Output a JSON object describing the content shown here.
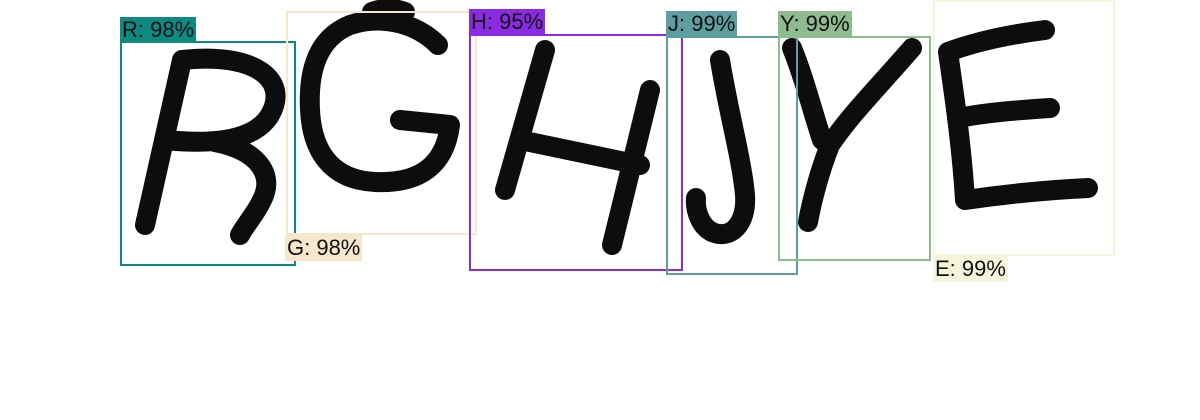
{
  "detections": [
    {
      "name": "R",
      "label": "R: 98%",
      "color": "#0e8a80"
    },
    {
      "name": "G",
      "label": "G: 98%",
      "color": "#f5e6cc"
    },
    {
      "name": "H",
      "label": "H: 95%",
      "color": "#8a2be2"
    },
    {
      "name": "J",
      "label": "J: 99%",
      "color": "#5f9ea0"
    },
    {
      "name": "Y",
      "label": "Y: 99%",
      "color": "#8fbc8f"
    },
    {
      "name": "E",
      "label": "E: 99%",
      "color": "#f5f5dc"
    }
  ]
}
